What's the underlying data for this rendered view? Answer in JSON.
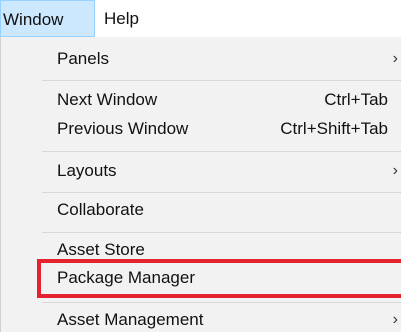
{
  "menubar": {
    "window_label": "Window",
    "help_label": "Help"
  },
  "menu": {
    "panels": {
      "label": "Panels",
      "arrow": "›"
    },
    "next_window": {
      "label": "Next Window",
      "shortcut": "Ctrl+Tab"
    },
    "previous_window": {
      "label": "Previous Window",
      "shortcut": "Ctrl+Shift+Tab"
    },
    "layouts": {
      "label": "Layouts",
      "arrow": "›"
    },
    "collaborate": {
      "label": "Collaborate"
    },
    "asset_store": {
      "label": "Asset Store"
    },
    "package_manager": {
      "label": "Package Manager"
    },
    "asset_management": {
      "label": "Asset Management",
      "arrow": "›"
    }
  },
  "colors": {
    "highlight_border": "#e5232f",
    "menu_background": "#f2f2f2",
    "active_menubar_background": "#cce8ff"
  }
}
